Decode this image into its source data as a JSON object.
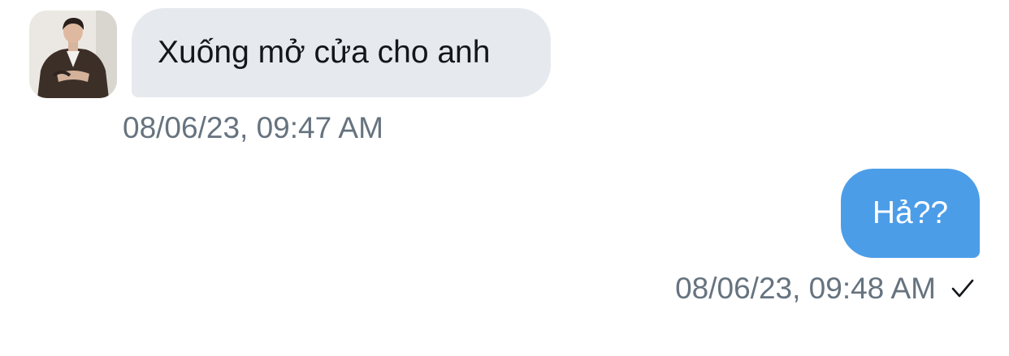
{
  "conversation": {
    "messages": [
      {
        "direction": "incoming",
        "text": "Xuống mở cửa cho anh",
        "timestamp": "08/06/23, 09:47 AM",
        "avatar": "contact-avatar-photo"
      },
      {
        "direction": "outgoing",
        "text": "Hả??",
        "timestamp": "08/06/23, 09:48 AM",
        "status_icon": "checkmark-icon"
      }
    ]
  },
  "colors": {
    "incoming_bubble": "#e6e9ee",
    "outgoing_bubble": "#4c9de8",
    "timestamp_text": "#66737f",
    "incoming_text": "#14171a",
    "outgoing_text": "#ffffff"
  }
}
